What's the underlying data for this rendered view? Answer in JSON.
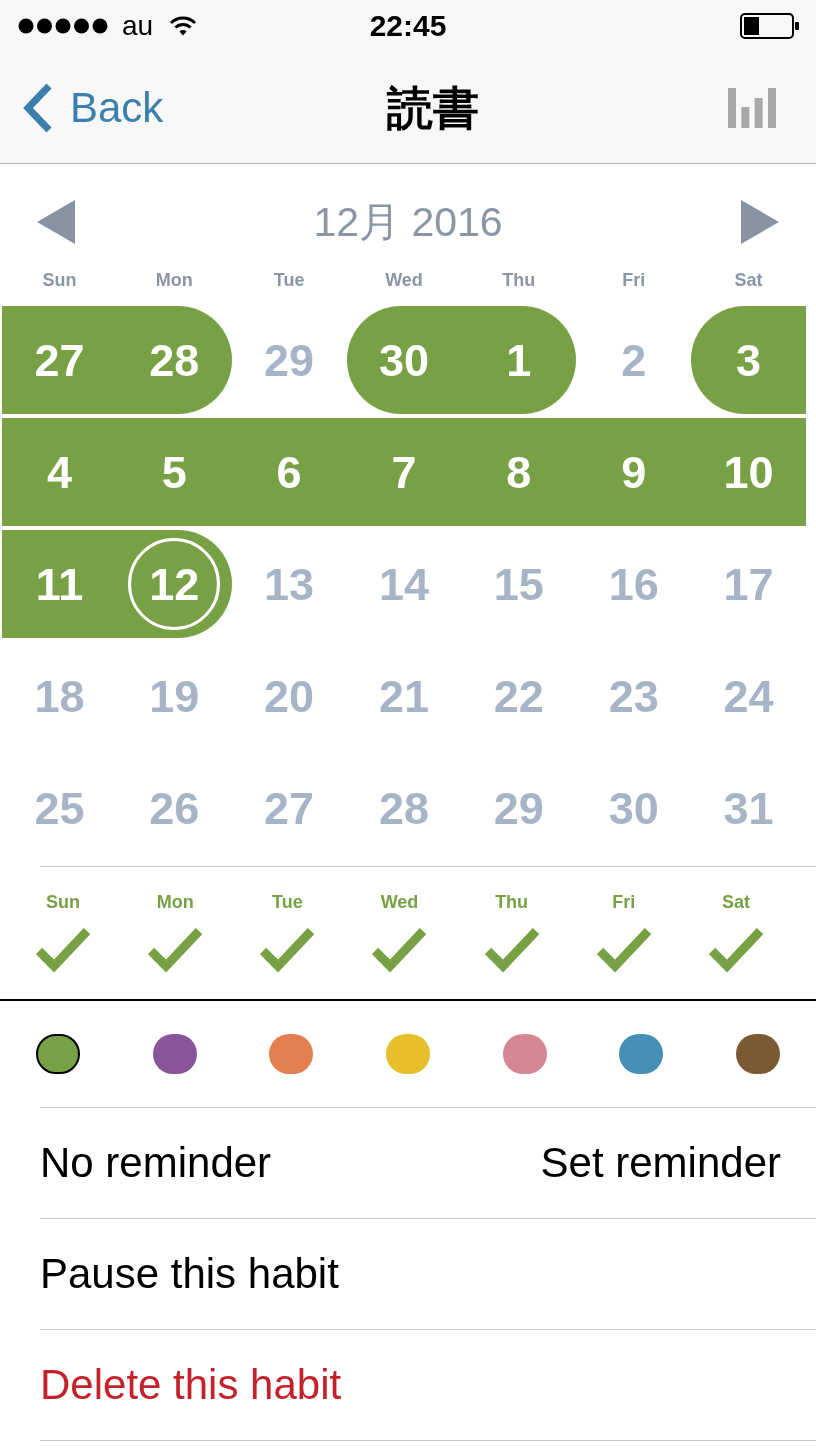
{
  "status_bar": {
    "carrier": "au",
    "time": "22:45"
  },
  "nav_bar": {
    "back_label": "Back",
    "title": "読書"
  },
  "calendar": {
    "month_label": "12月 2016",
    "weekdays": [
      "Sun",
      "Mon",
      "Tue",
      "Wed",
      "Thu",
      "Fri",
      "Sat"
    ],
    "weeks": [
      {
        "days": [
          {
            "label": "27",
            "done": true,
            "today": false
          },
          {
            "label": "28",
            "done": true,
            "today": false
          },
          {
            "label": "29",
            "done": false,
            "today": false
          },
          {
            "label": "30",
            "done": true,
            "today": false
          },
          {
            "label": "1",
            "done": true,
            "today": false
          },
          {
            "label": "2",
            "done": false,
            "today": false
          },
          {
            "label": "3",
            "done": true,
            "today": false
          }
        ]
      },
      {
        "days": [
          {
            "label": "4",
            "done": true,
            "today": false
          },
          {
            "label": "5",
            "done": true,
            "today": false
          },
          {
            "label": "6",
            "done": true,
            "today": false
          },
          {
            "label": "7",
            "done": true,
            "today": false
          },
          {
            "label": "8",
            "done": true,
            "today": false
          },
          {
            "label": "9",
            "done": true,
            "today": false
          },
          {
            "label": "10",
            "done": true,
            "today": false
          }
        ]
      },
      {
        "days": [
          {
            "label": "11",
            "done": true,
            "today": false
          },
          {
            "label": "12",
            "done": true,
            "today": true
          },
          {
            "label": "13",
            "done": false,
            "today": false
          },
          {
            "label": "14",
            "done": false,
            "today": false
          },
          {
            "label": "15",
            "done": false,
            "today": false
          },
          {
            "label": "16",
            "done": false,
            "today": false
          },
          {
            "label": "17",
            "done": false,
            "today": false
          }
        ]
      },
      {
        "days": [
          {
            "label": "18",
            "done": false,
            "today": false
          },
          {
            "label": "19",
            "done": false,
            "today": false
          },
          {
            "label": "20",
            "done": false,
            "today": false
          },
          {
            "label": "21",
            "done": false,
            "today": false
          },
          {
            "label": "22",
            "done": false,
            "today": false
          },
          {
            "label": "23",
            "done": false,
            "today": false
          },
          {
            "label": "24",
            "done": false,
            "today": false
          }
        ]
      },
      {
        "days": [
          {
            "label": "25",
            "done": false,
            "today": false
          },
          {
            "label": "26",
            "done": false,
            "today": false
          },
          {
            "label": "27",
            "done": false,
            "today": false
          },
          {
            "label": "28",
            "done": false,
            "today": false
          },
          {
            "label": "29",
            "done": false,
            "today": false
          },
          {
            "label": "30",
            "done": false,
            "today": false
          },
          {
            "label": "31",
            "done": false,
            "today": false
          }
        ]
      }
    ]
  },
  "repeat_days": [
    {
      "label": "Sun",
      "checked": true
    },
    {
      "label": "Mon",
      "checked": true
    },
    {
      "label": "Tue",
      "checked": true
    },
    {
      "label": "Wed",
      "checked": true
    },
    {
      "label": "Thu",
      "checked": true
    },
    {
      "label": "Fri",
      "checked": true
    },
    {
      "label": "Sat",
      "checked": true
    }
  ],
  "colors": [
    {
      "color": "#78a146",
      "selected": true
    },
    {
      "color": "#8a5598",
      "selected": false
    },
    {
      "color": "#e37f4f",
      "selected": false
    },
    {
      "color": "#e8bf2b",
      "selected": false
    },
    {
      "color": "#d48692",
      "selected": false
    },
    {
      "color": "#4690b6",
      "selected": false
    },
    {
      "color": "#7a5a33",
      "selected": false
    }
  ],
  "reminder": {
    "label": "No reminder",
    "action": "Set reminder"
  },
  "actions": [
    {
      "label": "Pause this habit",
      "kind": "normal"
    },
    {
      "label": "Delete this habit",
      "kind": "destructive"
    }
  ]
}
